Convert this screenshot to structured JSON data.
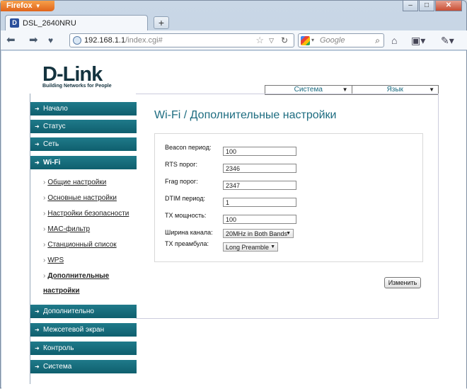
{
  "browser": {
    "app_button": "Firefox",
    "tab_title": "DSL_2640NRU",
    "url_host": "192.168.1.1",
    "url_path": "/index.cgi#",
    "search_placeholder": "Google"
  },
  "logo": {
    "name": "D-Link",
    "tagline": "Building Networks for People"
  },
  "top_selects": {
    "system": "Система",
    "language": "Язык"
  },
  "sidebar": {
    "menu": [
      {
        "label": "Начало"
      },
      {
        "label": "Статус"
      },
      {
        "label": "Сеть"
      },
      {
        "label": "Wi-Fi"
      },
      {
        "label": "Дополнительно"
      },
      {
        "label": "Межсетевой экран"
      },
      {
        "label": "Контроль"
      },
      {
        "label": "Система"
      }
    ],
    "submenu": [
      {
        "label": "Общие настройки"
      },
      {
        "label": "Основные настройки"
      },
      {
        "label": "Настройки безопасности"
      },
      {
        "label": "MAC-фильтр"
      },
      {
        "label": "Станционный список"
      },
      {
        "label": "WPS"
      },
      {
        "label": "Дополнительные"
      },
      {
        "label": "настройки"
      }
    ]
  },
  "main": {
    "title": "Wi-Fi / Дополнительные настройки",
    "fields": [
      {
        "label": "Beacon период:",
        "value": "100"
      },
      {
        "label": "RTS порог:",
        "value": "2346"
      },
      {
        "label": "Frag порог:",
        "value": "2347"
      },
      {
        "label": "DTIM период:",
        "value": "1"
      },
      {
        "label": "TX мощность:",
        "value": "100"
      }
    ],
    "channel_width": {
      "label": "Ширина канала:",
      "value": "20MHz in Both Bands"
    },
    "tx_preamble": {
      "label": "TX преамбула:",
      "value": "Long Preamble"
    },
    "apply_button": "Изменить"
  }
}
